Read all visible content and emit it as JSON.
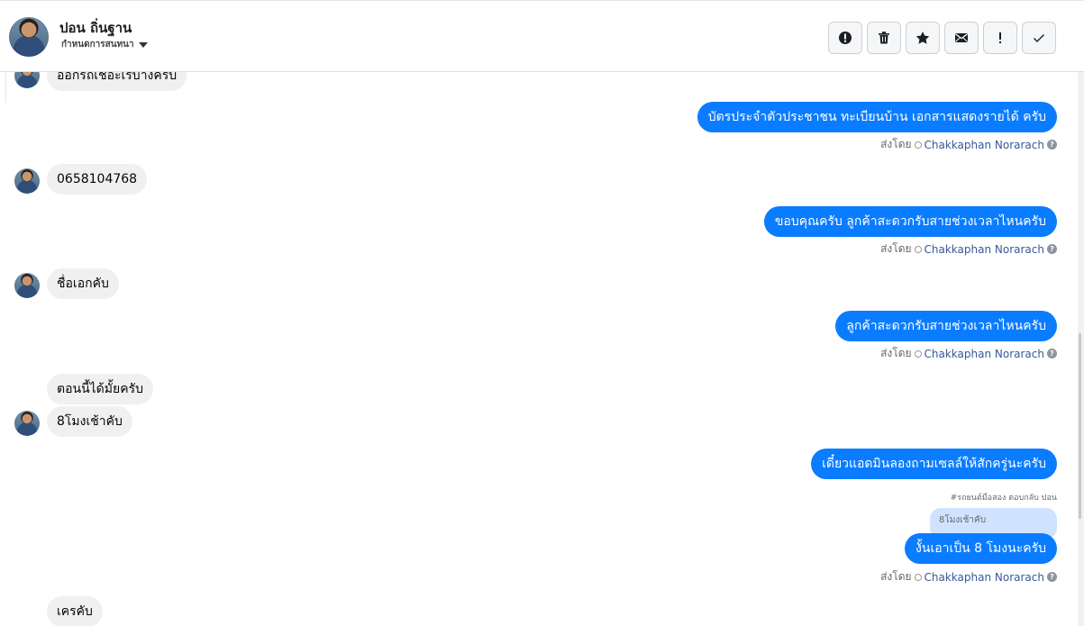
{
  "header": {
    "contact_name": "ปอน ถิ่นฐาน",
    "subtitle": "กำหนดการสนทนา",
    "toolbar": [
      {
        "name": "report-button",
        "icon": "alert-circle-icon"
      },
      {
        "name": "delete-button",
        "icon": "trash-icon"
      },
      {
        "name": "star-button",
        "icon": "star-icon"
      },
      {
        "name": "mark-unread-button",
        "icon": "envelope-icon"
      },
      {
        "name": "important-button",
        "icon": "exclamation-icon"
      },
      {
        "name": "done-button",
        "icon": "check-icon"
      }
    ]
  },
  "messages": {
    "in_0": "ออกรถเชอะเรบ้างครับ",
    "out_1": "บัตรประจำตัวประชาชน ทะเบียนบ้าน เอกสารแสดงรายได้ ครับ",
    "in_2": "0658104768",
    "out_3": "ขอบคุณครับ ลูกค้าสะดวกรับสายช่วงเวลาไหนครับ",
    "in_4": "ชื่อเอกคับ",
    "out_5": "ลูกค้าสะดวกรับสายช่วงเวลาไหนครับ",
    "in_6": "ตอนนี้ได้มั้ยครับ",
    "in_7": "8โมงเช้าคับ",
    "out_8": "เดี๋ยวแอดมินลองถามเซลล์ให้สักครู่นะครับ",
    "reply_note": "#รถยนต์มือสอง ตอบกลับ ปอน",
    "reply_quote": "8โมงเช้าคับ",
    "out_9": "งั้นเอาเป็น 8 โมงนะครับ",
    "in_10": "เครคับ"
  },
  "sent_by": {
    "prefix": "ส่งโดย",
    "agent": "Chakkaphan Norarach"
  },
  "colors": {
    "outgoing_bubble": "#0a7cff",
    "incoming_bubble": "#f0f0f0",
    "reply_quote_bg": "#cfe3ff",
    "agent_link": "#385898"
  }
}
